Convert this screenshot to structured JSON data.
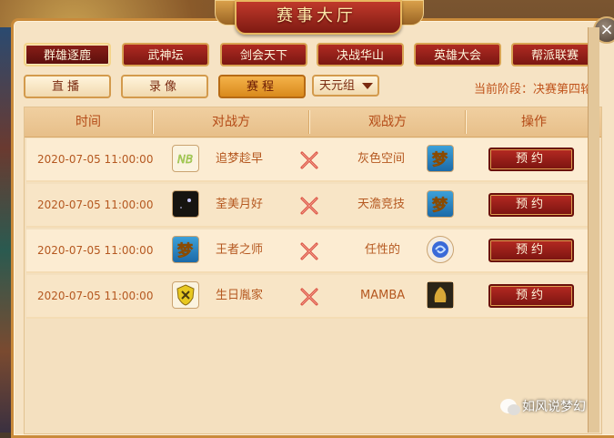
{
  "window": {
    "title": "赛事大厅",
    "close_glyph": "×"
  },
  "categories": [
    {
      "label": "群雄逐鹿",
      "active": true
    },
    {
      "label": "武神坛",
      "active": false
    },
    {
      "label": "剑会天下",
      "active": false
    },
    {
      "label": "决战华山",
      "active": false
    },
    {
      "label": "英雄大会",
      "active": false
    },
    {
      "label": "帮派联赛",
      "active": false
    }
  ],
  "sub_tabs": [
    {
      "label": "直播",
      "active": false
    },
    {
      "label": "录像",
      "active": false
    },
    {
      "label": "赛程",
      "active": true
    }
  ],
  "group_select": {
    "value": "天元组"
  },
  "stage": {
    "text": "当前阶段：决赛第四轮"
  },
  "table": {
    "headers": [
      "时间",
      "对战方",
      "观战方",
      "操作"
    ],
    "rows": [
      {
        "time": "2020-07-05 11:00:00",
        "team_a": "追梦趁早",
        "team_a_emblem": "nb-logo",
        "team_b": "灰色空间",
        "team_b_emblem": "meng-logo",
        "action": "预约"
      },
      {
        "time": "2020-07-05 11:00:00",
        "team_a": "荃美月好",
        "team_a_emblem": "dark-night-logo",
        "team_b": "天澹竞技",
        "team_b_emblem": "meng-logo",
        "action": "预约"
      },
      {
        "time": "2020-07-05 11:00:00",
        "team_a": "王者之师",
        "team_a_emblem": "meng-logo",
        "team_b": "任性的",
        "team_b_emblem": "blue-swirl-logo",
        "action": "预约"
      },
      {
        "time": "2020-07-05 11:00:00",
        "team_a": "生日胤家",
        "team_a_emblem": "shield-x-logo",
        "team_b": "MAMBA",
        "team_b_emblem": "mamba-logo",
        "action": "预约"
      }
    ]
  },
  "watermark": {
    "text": "如风说梦幻"
  },
  "colors": {
    "accent_red": "#b02a22",
    "gold_border": "#d9a352",
    "text_orange": "#b55820"
  }
}
